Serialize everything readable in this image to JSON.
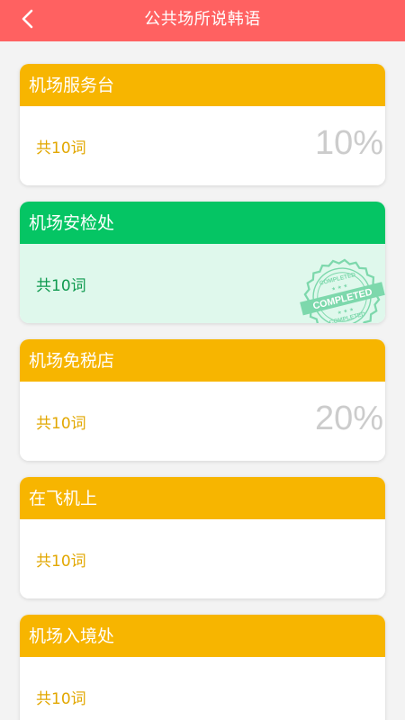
{
  "header": {
    "title": "公共场所说韩语",
    "back_icon": "chevron-left-icon"
  },
  "colors": {
    "header": "#ff6161",
    "card_header_default": "#f7b500",
    "card_header_completed": "#05c564",
    "card_body_completed": "#dff8ec",
    "count_default": "#e2a700",
    "count_completed": "#0f9a4f",
    "percent": "#cccccc",
    "stamp": "#7dd8ac"
  },
  "stamp": {
    "text": "COMPLETED",
    "icon": "completed-stamp-icon"
  },
  "lessons": [
    {
      "title": "机场服务台",
      "count": "共10词",
      "percent": "10%",
      "completed": false
    },
    {
      "title": "机场安检处",
      "count": "共10词",
      "percent": "",
      "completed": true
    },
    {
      "title": "机场免税店",
      "count": "共10词",
      "percent": "20%",
      "completed": false
    },
    {
      "title": "在飞机上",
      "count": "共10词",
      "percent": "",
      "completed": false
    },
    {
      "title": "机场入境处",
      "count": "共10词",
      "percent": "",
      "completed": false
    }
  ]
}
